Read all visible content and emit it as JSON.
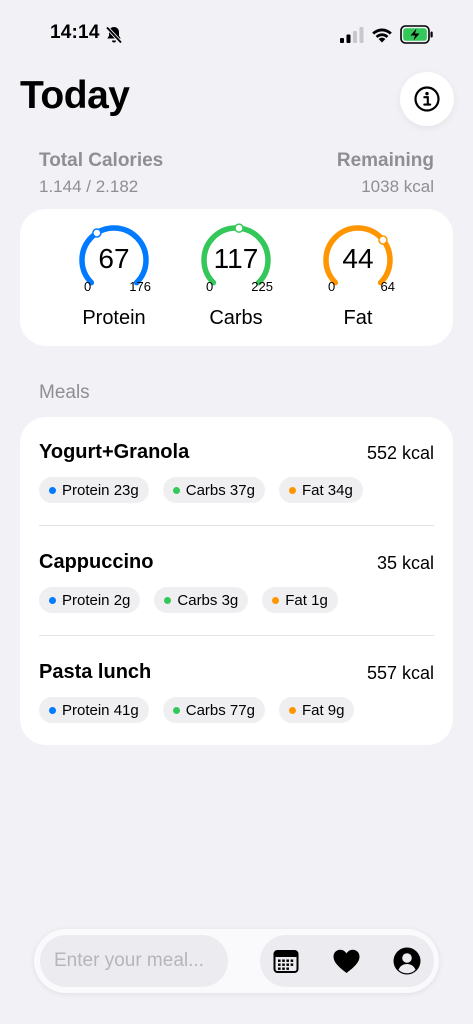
{
  "status_bar": {
    "time": "14:14"
  },
  "header": {
    "title": "Today"
  },
  "totals": {
    "total_label": "Total Calories",
    "total_value": "1.144 / 2.182",
    "remaining_label": "Remaining",
    "remaining_value": "1038 kcal"
  },
  "macros": [
    {
      "label": "Protein",
      "value": "67",
      "min": "0",
      "max": "176",
      "color": "#007aff",
      "progress": 0.38
    },
    {
      "label": "Carbs",
      "value": "117",
      "min": "0",
      "max": "225",
      "color": "#34c759",
      "progress": 0.52
    },
    {
      "label": "Fat",
      "value": "44",
      "min": "0",
      "max": "64",
      "color": "#ff9500",
      "progress": 0.69
    }
  ],
  "meals_section": {
    "title": "Meals"
  },
  "meals": [
    {
      "name": "Yogurt+Granola",
      "kcal": "552 kcal",
      "protein": "Protein 23g",
      "carbs": "Carbs 37g",
      "fat": "Fat 34g"
    },
    {
      "name": "Cappuccino",
      "kcal": "35 kcal",
      "protein": "Protein 2g",
      "carbs": "Carbs 3g",
      "fat": "Fat 1g"
    },
    {
      "name": "Pasta lunch",
      "kcal": "557 kcal",
      "protein": "Protein 41g",
      "carbs": "Carbs 77g",
      "fat": "Fat 9g"
    }
  ],
  "bottom_bar": {
    "input_placeholder": "Enter your meal...",
    "icons": [
      "calendar-icon",
      "heart-icon",
      "profile-icon"
    ]
  },
  "colors": {
    "protein": "#007aff",
    "carbs": "#34c759",
    "fat": "#ff9500"
  }
}
